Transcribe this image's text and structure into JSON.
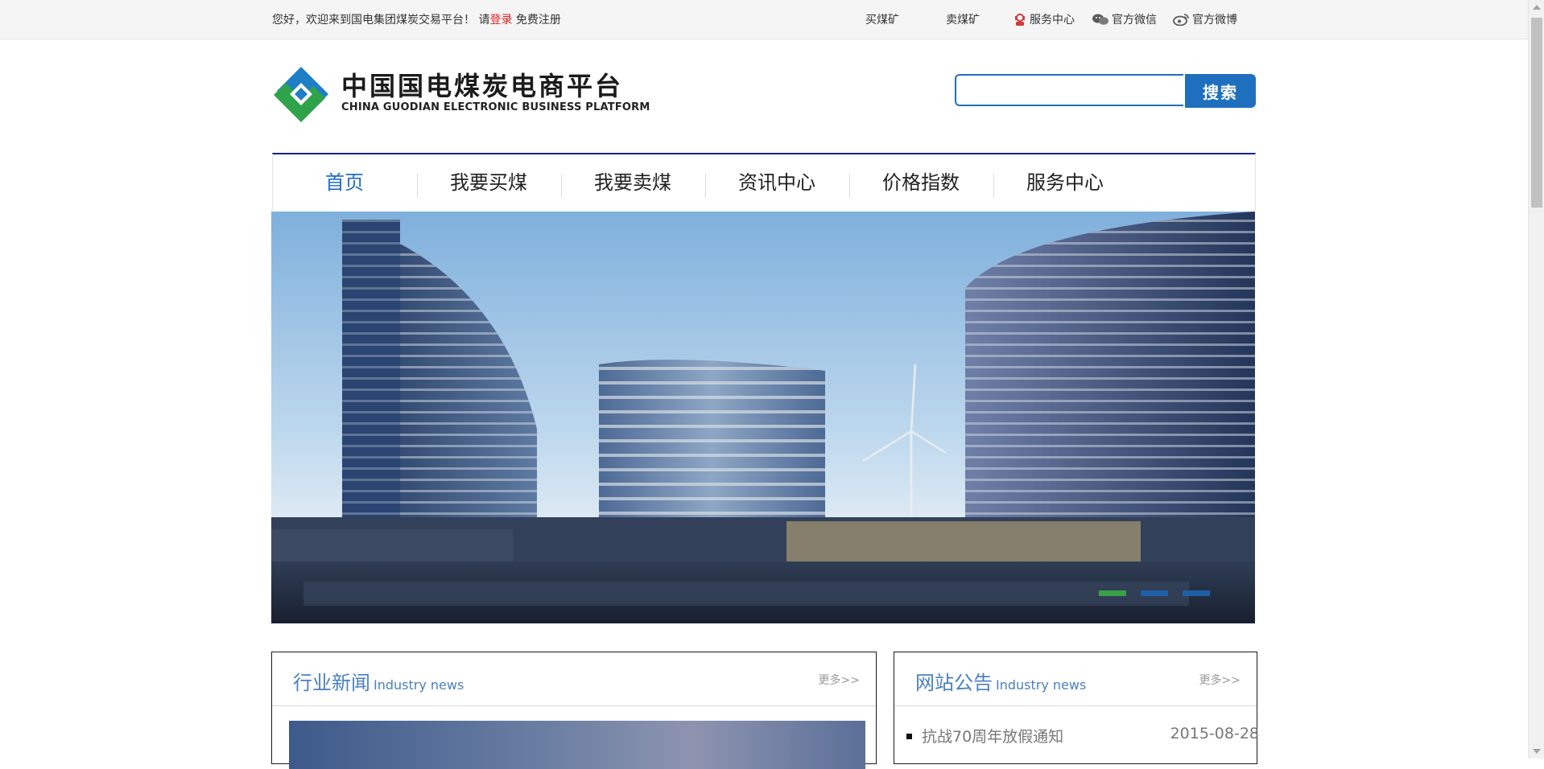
{
  "topbar": {
    "welcome": "您好，欢迎来到国电集团煤炭交易平台！ 请",
    "login": "登录",
    "register": "免费注册",
    "links": [
      {
        "label": "买煤矿",
        "icon": ""
      },
      {
        "label": "卖煤矿",
        "icon": ""
      },
      {
        "label": "服务中心",
        "icon": "customer-service-icon"
      },
      {
        "label": "官方微信",
        "icon": "wechat-icon"
      },
      {
        "label": "官方微博",
        "icon": "weibo-icon"
      }
    ]
  },
  "header": {
    "brand_cn": "中国国电煤炭电商平台",
    "brand_en": "CHINA GUODIAN ELECTRONIC BUSINESS PLATFORM",
    "search_placeholder": "",
    "search_button": "搜索"
  },
  "nav": {
    "items": [
      "首页",
      "我要买煤",
      "我要卖煤",
      "资讯中心",
      "价格指数",
      "服务中心"
    ],
    "active_index": 0
  },
  "carousel": {
    "slide_count": 3,
    "active_index": 0,
    "active_color": "#3aa047",
    "inactive_color": "#1f5fa8"
  },
  "news_panel": {
    "title": "行业新闻",
    "subtitle": "Industry news",
    "more": "更多>>"
  },
  "notice_panel": {
    "title": "网站公告",
    "subtitle": "Industry news",
    "more": "更多>>",
    "items": [
      {
        "title": "抗战70周年放假通知",
        "date": "2015-08-28"
      }
    ]
  },
  "colors": {
    "accent": "#1f6fbf",
    "nav_border": "#1a1f9b",
    "login_red": "#e02020",
    "panel_title": "#4a7fc1"
  }
}
